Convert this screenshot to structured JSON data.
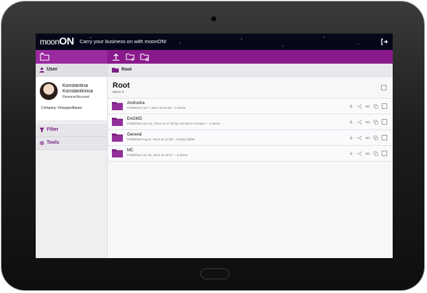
{
  "header": {
    "logo_text": "moon",
    "logo_strong": "ON",
    "tagline": "Carry your business on with moonON!"
  },
  "sidebar": {
    "user_section": "User",
    "user": {
      "first_name": "Konstantina",
      "last_name": "Konstantinova",
      "account_type": "Personal Account",
      "company": "Company: Omegasoftware"
    },
    "filter_label": "Filter",
    "tools_label": "Tools"
  },
  "breadcrumb": {
    "label": "Root"
  },
  "folder": {
    "title": "Root",
    "count": "items 4"
  },
  "items": [
    {
      "name": "Andrusha",
      "meta": "Published Jul 7, 2014 at 16:19 – 5 items"
    },
    {
      "name": "EAGMD",
      "meta": "Published Jun 24, 2014 at 17:45 by Veniamin Toropov – 2 items"
    },
    {
      "name": "General",
      "meta": "Published Aug 5, 2014 at 14:38 – Empty folder"
    },
    {
      "name": "MC",
      "meta": "Published Jul 18, 2014 at 10:17 – 2 items"
    }
  ],
  "colors": {
    "accent": "#8a1a8c",
    "accent_light": "#9b2aa0",
    "folder": "#7b1f80"
  },
  "icons": [
    "folder-icon",
    "upload-icon",
    "new-folder-icon",
    "folder-settings-icon",
    "logout-icon",
    "user-icon",
    "filter-icon",
    "gear-icon",
    "download-icon",
    "share-icon",
    "link-icon",
    "copy-icon"
  ]
}
